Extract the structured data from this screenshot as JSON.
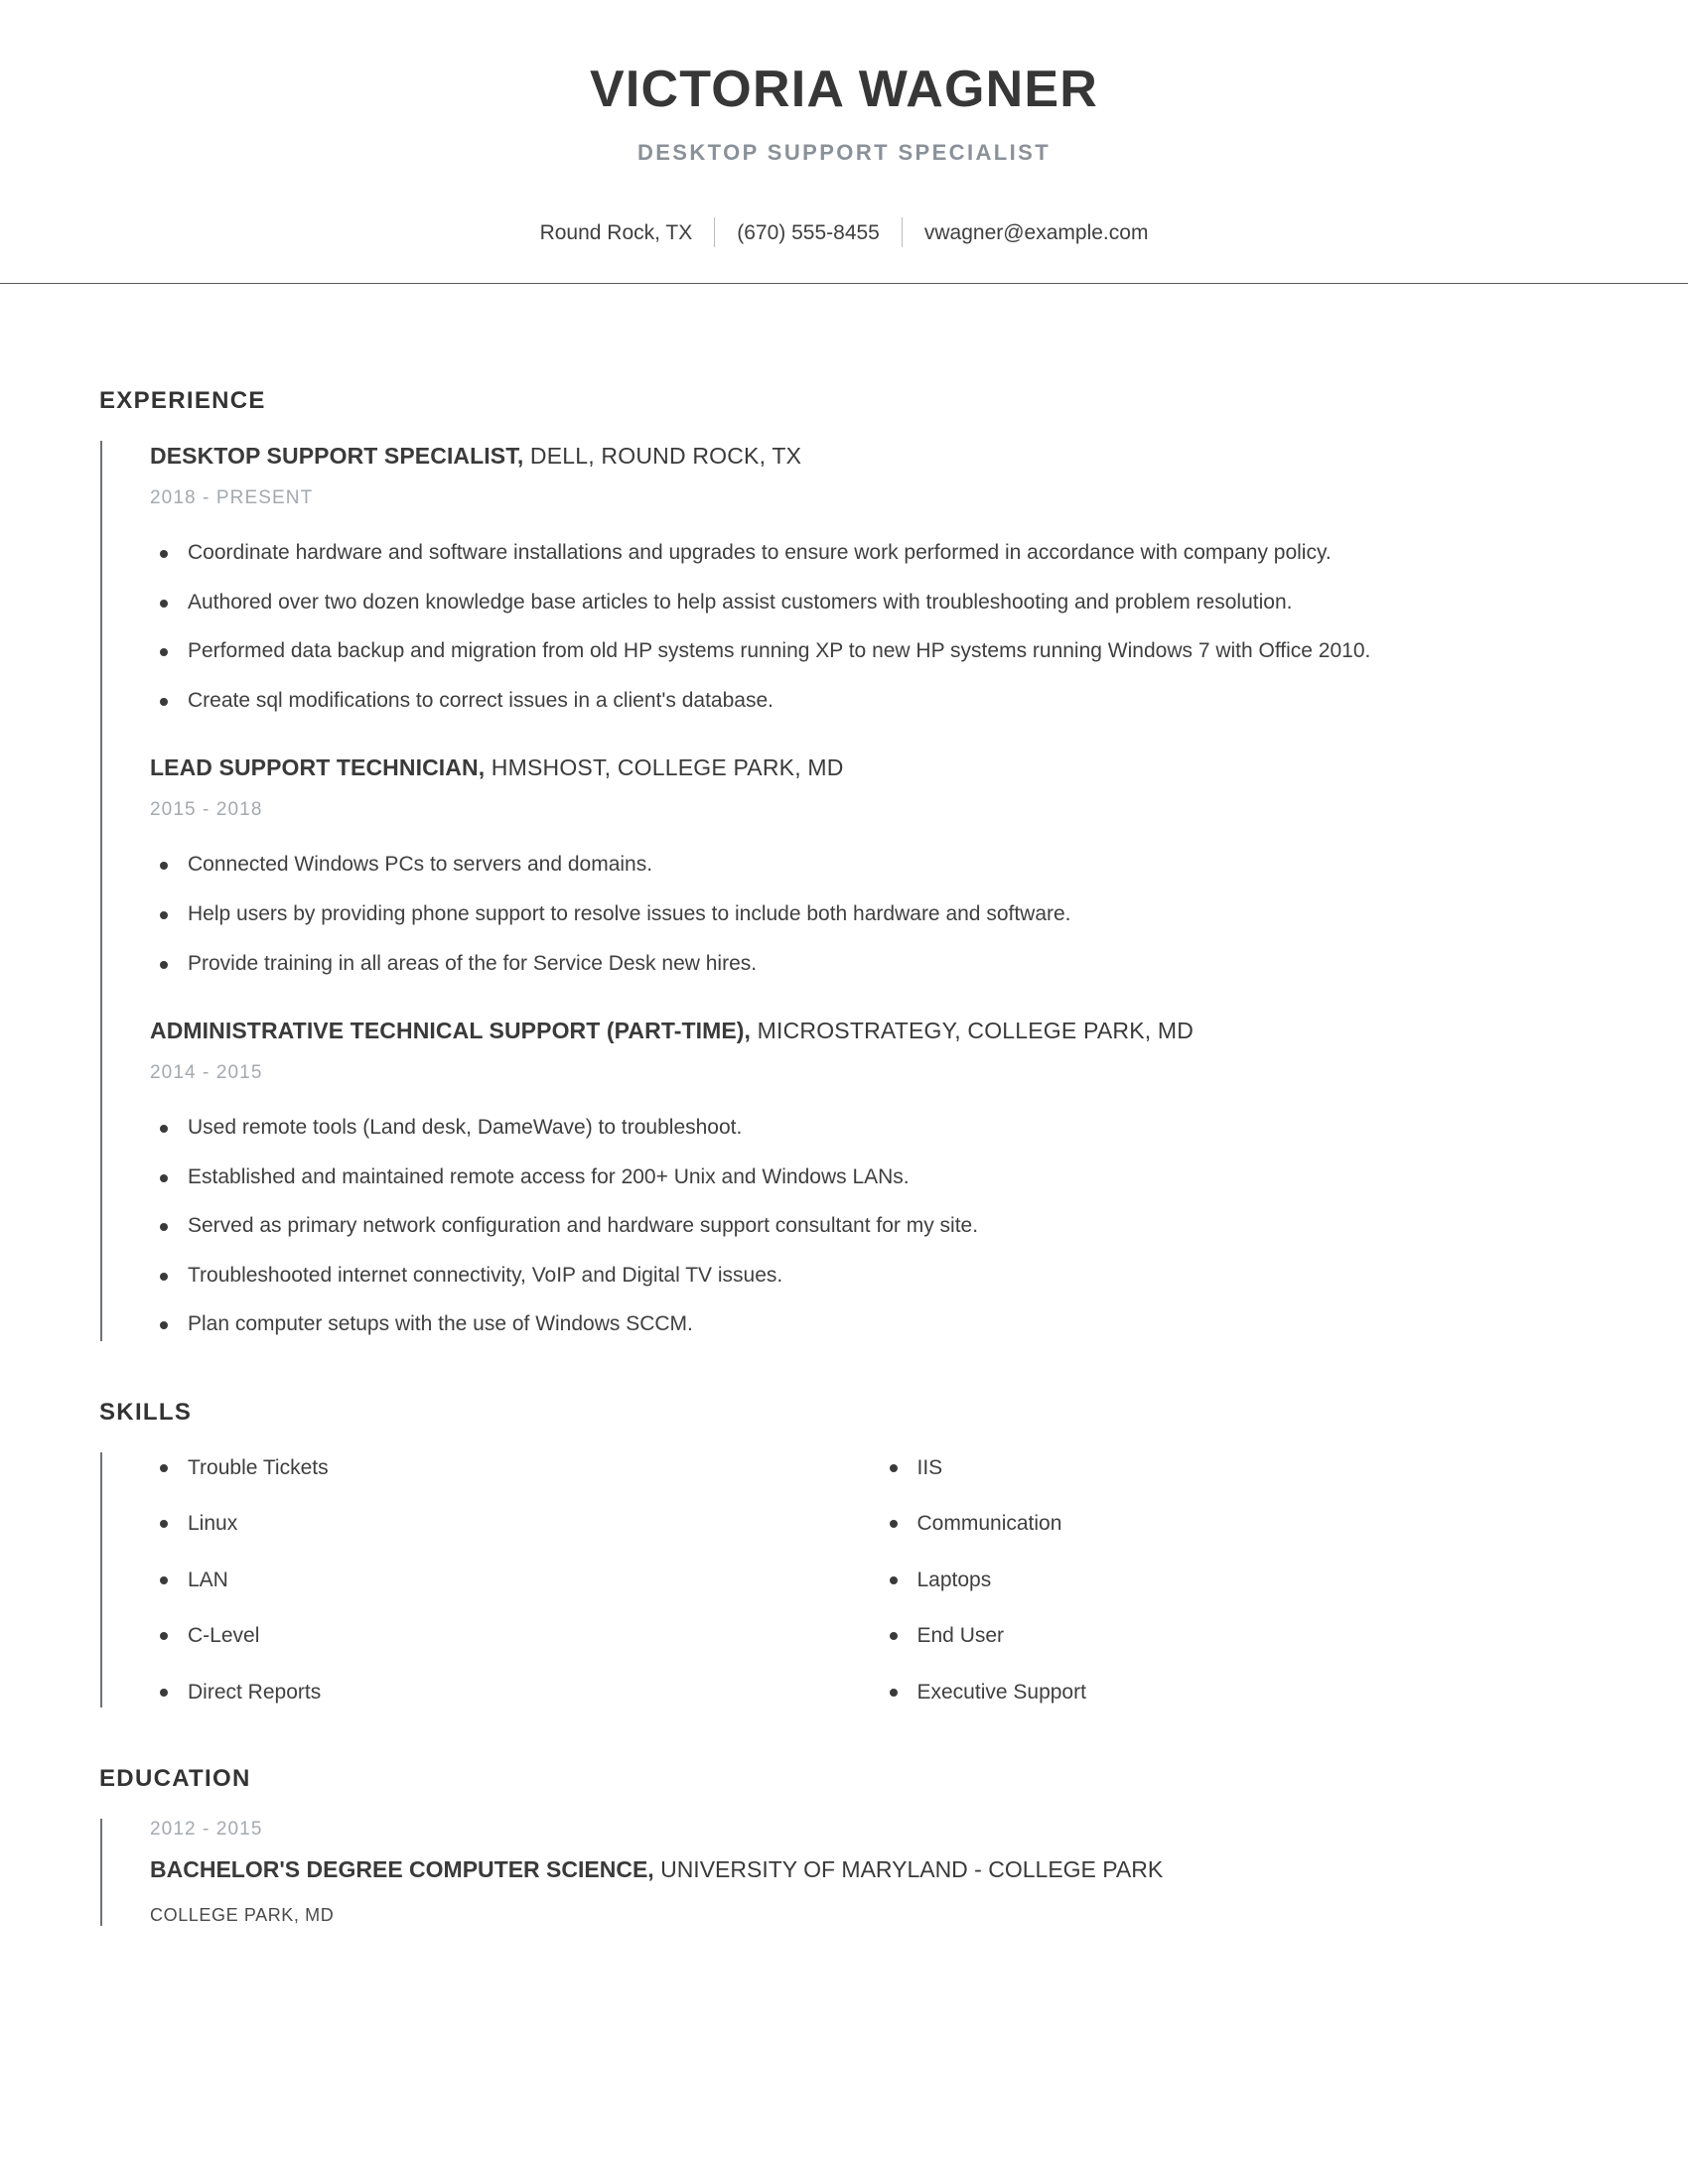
{
  "header": {
    "name": "VICTORIA WAGNER",
    "title": "DESKTOP SUPPORT SPECIALIST",
    "contact": {
      "location": "Round Rock, TX",
      "phone": "(670) 555-8455",
      "email": "vwagner@example.com"
    }
  },
  "sections": {
    "experience": {
      "title": "EXPERIENCE",
      "entries": [
        {
          "role": "DESKTOP SUPPORT SPECIALIST,",
          "org": " DELL, ROUND ROCK, TX",
          "dates": "2018 - PRESENT",
          "bullets": [
            "Coordinate hardware and software installations and upgrades to ensure work performed in accordance with company policy.",
            "Authored over two dozen knowledge base articles to help assist customers with troubleshooting and problem resolution.",
            "Performed data backup and migration from old HP systems running XP to new HP systems running Windows 7 with Office 2010.",
            "Create sql modifications to correct issues in a client's database."
          ]
        },
        {
          "role": "LEAD SUPPORT TECHNICIAN,",
          "org": " HMSHOST, COLLEGE PARK, MD",
          "dates": "2015 - 2018",
          "bullets": [
            "Connected Windows PCs to servers and domains.",
            "Help users by providing phone support to resolve issues to include both hardware and software.",
            "Provide training in all areas of the for Service Desk new hires."
          ]
        },
        {
          "role": "ADMINISTRATIVE TECHNICAL SUPPORT (PART-TIME),",
          "org": " MICROSTRATEGY, COLLEGE PARK, MD",
          "dates": "2014 - 2015",
          "bullets": [
            "Used remote tools (Land desk, DameWave) to troubleshoot.",
            "Established and maintained remote access for 200+ Unix and Windows LANs.",
            "Served as primary network configuration and hardware support consultant for my site.",
            "Troubleshooted internet connectivity, VoIP and Digital TV issues.",
            "Plan computer setups with the use of Windows SCCM."
          ]
        }
      ]
    },
    "skills": {
      "title": "SKILLS",
      "column_left": [
        "Trouble Tickets",
        "Linux",
        "LAN",
        "C-Level",
        "Direct Reports"
      ],
      "column_right": [
        "IIS",
        "Communication",
        "Laptops",
        "End User",
        "Executive Support"
      ]
    },
    "education": {
      "title": "EDUCATION",
      "entries": [
        {
          "dates": "2012 - 2015",
          "degree": "BACHELOR'S DEGREE COMPUTER SCIENCE,",
          "school": " UNIVERSITY OF MARYLAND - COLLEGE PARK",
          "location": "COLLEGE PARK, MD"
        }
      ]
    }
  }
}
